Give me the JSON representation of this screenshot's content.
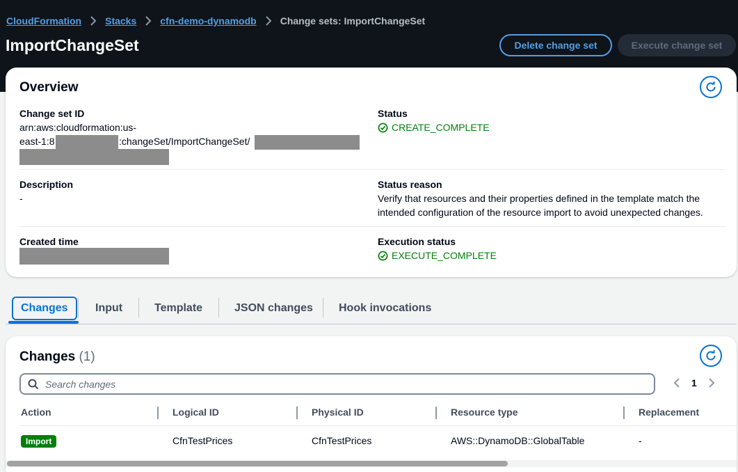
{
  "breadcrumb": {
    "items": [
      "CloudFormation",
      "Stacks",
      "cfn-demo-dynamodb"
    ],
    "current": "Change sets: ImportChangeSet"
  },
  "page": {
    "title": "ImportChangeSet",
    "delete_button": "Delete change set",
    "execute_button": "Execute change set"
  },
  "overview": {
    "title": "Overview",
    "change_set_id_label": "Change set ID",
    "change_set_id_line1": "arn:aws:cloudformation:us-",
    "change_set_id_line2a": "east-1:8",
    "change_set_id_line2b": ":changeSet/ImportChangeSet/",
    "status_label": "Status",
    "status_value": "CREATE_COMPLETE",
    "description_label": "Description",
    "description_value": "-",
    "status_reason_label": "Status reason",
    "status_reason_line1": "Verify that resources and their properties defined in the template match the",
    "status_reason_line2": "intended configuration of the resource import to avoid unexpected changes.",
    "created_time_label": "Created time",
    "execution_status_label": "Execution status",
    "execution_status_value": "EXECUTE_COMPLETE"
  },
  "tabs": [
    "Changes",
    "Input",
    "Template",
    "JSON changes",
    "Hook invocations"
  ],
  "changes": {
    "title": "Changes",
    "count": "(1)",
    "search_placeholder": "Search changes",
    "page_number": "1",
    "columns": [
      "Action",
      "Logical ID",
      "Physical ID",
      "Resource type",
      "Replacement"
    ],
    "rows": [
      {
        "action": "Import",
        "logical_id": "CfnTestPrices",
        "physical_id": "CfnTestPrices",
        "resource_type": "AWS::DynamoDB::GlobalTable",
        "replacement": "-"
      }
    ]
  },
  "colors": {
    "header_bg": "#0f141a",
    "link": "#539fe5",
    "accent": "#0972d3",
    "success": "#037f0c"
  },
  "icons": [
    "chevron-right-icon",
    "refresh-icon",
    "status-positive-icon",
    "search-icon",
    "chevron-left-icon"
  ]
}
